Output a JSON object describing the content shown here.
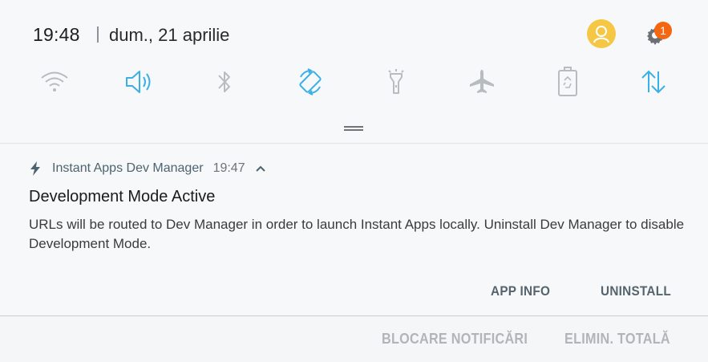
{
  "status": {
    "time": "19:48",
    "date": "dum., 21 aprilie",
    "settings_badge": "1"
  },
  "quick_toggles": [
    {
      "icon": "wifi-icon",
      "active": false
    },
    {
      "icon": "sound-icon",
      "active": true
    },
    {
      "icon": "bluetooth-icon",
      "active": false
    },
    {
      "icon": "auto-rotate-icon",
      "active": true
    },
    {
      "icon": "flashlight-icon",
      "active": false
    },
    {
      "icon": "airplane-mode-icon",
      "active": false
    },
    {
      "icon": "power-saving-icon",
      "active": false
    },
    {
      "icon": "mobile-data-icon",
      "active": true
    }
  ],
  "colors": {
    "active": "#3ab0e6",
    "inactive": "#b7bcc0",
    "badge": "#f4660f",
    "avatar": "#f6c745"
  },
  "notification": {
    "app_name": "Instant Apps Dev Manager",
    "time": "19:47",
    "title": "Development Mode Active",
    "body": "URLs will be routed to Dev Manager in order to launch Instant Apps locally. Uninstall Dev Manager to disable Development Mode.",
    "actions": {
      "app_info": "APP INFO",
      "uninstall": "UNINSTALL"
    }
  },
  "bottom_actions": {
    "block": "BLOCARE NOTIFICĂRI",
    "clear_all": "ELIMIN. TOTALĂ"
  }
}
